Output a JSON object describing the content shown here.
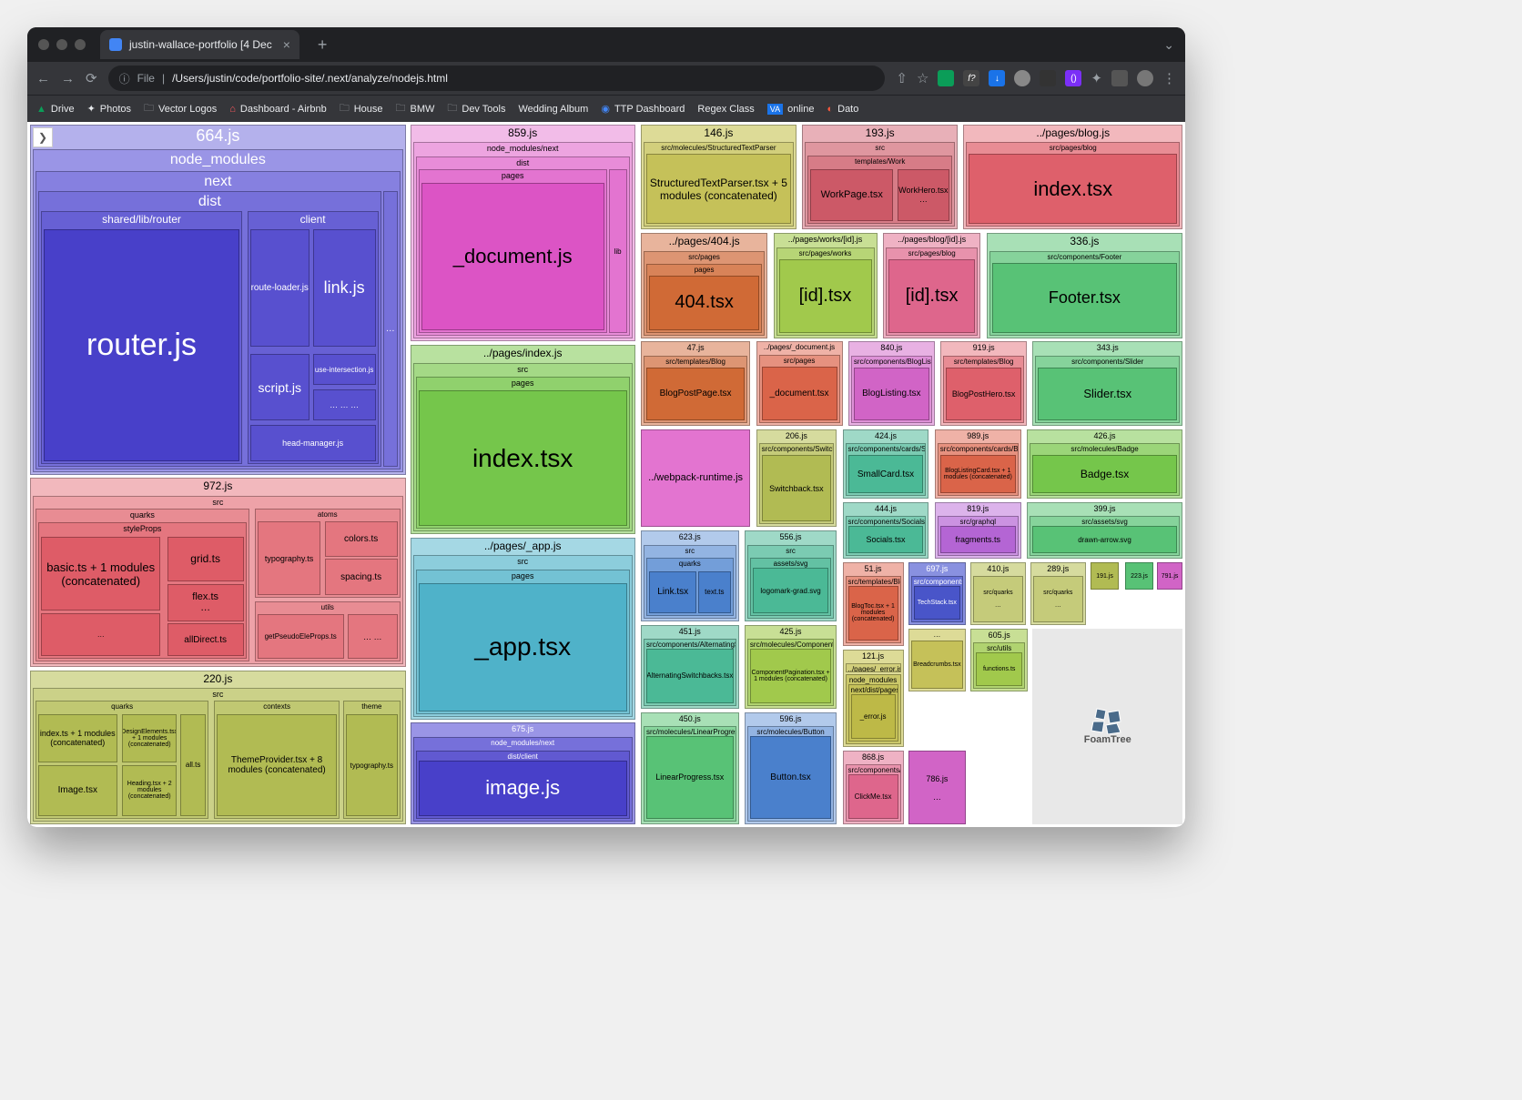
{
  "browser": {
    "tab_title": "justin-wallace-portfolio [4 Dec",
    "url_prefix": "File",
    "url_path": "/Users/justin/code/portfolio-site/.next/analyze/nodejs.html",
    "bookmarks": [
      {
        "label": "Drive"
      },
      {
        "label": "Photos"
      },
      {
        "label": "Vector Logos"
      },
      {
        "label": "Dashboard - Airbnb"
      },
      {
        "label": "House"
      },
      {
        "label": "BMW"
      },
      {
        "label": "Dev Tools"
      },
      {
        "label": "Wedding Album"
      },
      {
        "label": "TTP Dashboard"
      },
      {
        "label": "Regex Class"
      },
      {
        "label": "online"
      },
      {
        "label": "Dato"
      }
    ]
  },
  "logo": "FoamTree",
  "blocks": {
    "b664": {
      "t": "664.js",
      "p": "node_modules",
      "p2": "next",
      "p3": "dist"
    },
    "router_parent": "shared/lib/router",
    "client": "client",
    "routerjs": "router.js",
    "routeloader": "route-loader.js",
    "linkjs": "link.js",
    "scriptjs": "script.js",
    "useinter": "use-intersection.js",
    "headmgr": "head-manager.js",
    "b972": {
      "t": "972.js",
      "s": "src",
      "q": "quarks",
      "sp": "styleProps",
      "basic": "basic.ts + 1 modules (concatenated)",
      "grid": "grid.ts",
      "flex": "flex.ts",
      "alldirect": "allDirect.ts",
      "atoms": "atoms",
      "colors": "colors.ts",
      "typo": "typography.ts",
      "spacing": "spacing.ts",
      "utils": "utils",
      "getpseudo": "getPseudoEleProps.ts"
    },
    "b220": {
      "t": "220.js",
      "s": "src",
      "q": "quarks",
      "idx": "index.ts + 1 modules (concatenated)",
      "img": "Image.tsx",
      "design": "DesignElements.tsx + 1 modules (concatenated)",
      "head": "Heading.tsx + 2 modules (concatenated)",
      "allts": "all.ts",
      "ctx": "contexts",
      "theme": "ThemeProvider.tsx + 8 modules (concatenated)",
      "th": "theme",
      "tp": "typography.ts"
    },
    "b859": {
      "t": "859.js",
      "nm": "node_modules/next",
      "dist": "dist",
      "pages": "pages",
      "lib": "lib",
      "doc": "_document.js"
    },
    "pidx": {
      "t": "../pages/index.js",
      "s": "src",
      "p": "pages",
      "idx": "index.tsx"
    },
    "papp": {
      "t": "../pages/_app.js",
      "s": "src",
      "p": "pages",
      "app": "_app.tsx"
    },
    "b675": {
      "t": "675.js",
      "nm": "node_modules/next",
      "dc": "dist/client",
      "img": "image.js"
    },
    "b146": {
      "t": "146.js",
      "p": "src/molecules/StructuredTextParser",
      "m": "StructuredTextParser.tsx + 5 modules (concatenated)"
    },
    "b193": {
      "t": "193.js",
      "s": "src",
      "tw": "templates/Work",
      "wp": "WorkPage.tsx",
      "wh": "WorkHero.tsx"
    },
    "pblog": {
      "t": "../pages/blog.js",
      "p": "src/pages/blog",
      "idx": "index.tsx"
    },
    "p404": {
      "t": "../pages/404.js",
      "p": "src/pages",
      "pp": "pages",
      "m": "404.tsx"
    },
    "pwid": {
      "t": "../pages/works/[id].js",
      "p": "src/pages/works",
      "m": "[id].tsx"
    },
    "pbid": {
      "t": "../pages/blog/[id].js",
      "p": "src/pages/blog",
      "m": "[id].tsx"
    },
    "b336": {
      "t": "336.js",
      "p": "src/components/Footer",
      "m": "Footer.tsx"
    },
    "b47": {
      "t": "47.js",
      "p": "src/templates/Blog",
      "m": "BlogPostPage.tsx"
    },
    "pdoc": {
      "t": "../pages/_document.js",
      "p": "src/pages",
      "m": "_document.tsx"
    },
    "b840": {
      "t": "840.js",
      "p": "src/components/BlogListing",
      "m": "BlogListing.tsx"
    },
    "b919": {
      "t": "919.js",
      "p": "src/templates/Blog",
      "m": "BlogPostHero.tsx"
    },
    "b343": {
      "t": "343.js",
      "p": "src/components/Slider",
      "m": "Slider.tsx"
    },
    "wrt": {
      "t": "../webpack-runtime.js"
    },
    "b206": {
      "t": "206.js",
      "p": "src/components/Switchback",
      "m": "Switchback.tsx"
    },
    "b424": {
      "t": "424.js",
      "p": "src/components/cards/SmallCard",
      "m": "SmallCard.tsx"
    },
    "b989": {
      "t": "989.js",
      "p": "src/components/cards/BlogListingCard",
      "m": "BlogListingCard.tsx + 1 modules (concatenated)"
    },
    "b426": {
      "t": "426.js",
      "p": "src/molecules/Badge",
      "m": "Badge.tsx"
    },
    "b623": {
      "t": "623.js",
      "s": "src",
      "q": "quarks",
      "link": "Link.tsx",
      "txt": "text.ts"
    },
    "b556": {
      "t": "556.js",
      "s": "src",
      "a": "assets/svg",
      "m": "logomark-grad.svg"
    },
    "b444": {
      "t": "444.js",
      "p": "src/components/Socials",
      "m": "Socials.tsx"
    },
    "b819": {
      "t": "819.js",
      "p": "src/graphql",
      "m": "fragments.ts"
    },
    "b399": {
      "t": "399.js",
      "p": "src/assets/svg",
      "m": "drawn-arrow.svg"
    },
    "b451": {
      "t": "451.js",
      "p": "src/components/AlternatingSwitchbacks",
      "m": "AlternatingSwitchbacks.tsx"
    },
    "b425": {
      "t": "425.js",
      "p": "src/molecules/ComponentPagination",
      "m": "ComponentPagination.tsx + 1 modules (concatenated)"
    },
    "b51": {
      "t": "51.js",
      "p": "src/templates/Blog",
      "m": "BlogToc.tsx + 1 modules (concatenated)"
    },
    "b697": {
      "t": "697.js",
      "p": "src/components/TechStack",
      "m": "TechStack.tsx"
    },
    "b410": {
      "t": "410.js",
      "p": "src/quarks"
    },
    "b289": {
      "t": "289.js",
      "p": "src/quarks"
    },
    "b450": {
      "t": "450.js",
      "p": "src/molecules/LinearProgress",
      "m": "LinearProgress.tsx"
    },
    "b596": {
      "t": "596.js",
      "p": "src/molecules/Button",
      "m": "Button.tsx"
    },
    "b121": {
      "t": "121.js",
      "p": "../pages/_error.js",
      "nm": "node_modules",
      "nx": "next/dist/pages",
      "m": "_error.js"
    },
    "b605": {
      "t": "605.js",
      "p": "src/utils",
      "m": "functions.ts"
    },
    "b868": {
      "t": "868.js",
      "p": "src/components/Navbar",
      "m": "ClickMe.tsx"
    },
    "b786": {
      "t": "786.js"
    },
    "b191": {
      "t": "191.js"
    },
    "b223": {
      "t": "223.js"
    },
    "b791": {
      "t": "791.js"
    },
    "breadcrumbs": "Breadcrumbs.tsx"
  }
}
